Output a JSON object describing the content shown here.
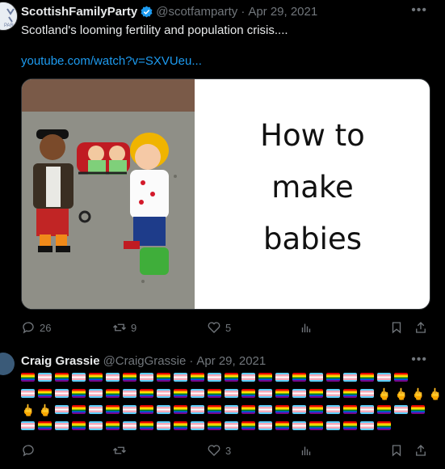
{
  "tweet1": {
    "author_name": "ScottishFamilyParty",
    "handle": "@scotfamparty",
    "separator": "·",
    "date": "Apr 29, 2021",
    "text": "Scotland's looming fertility and population crisis....",
    "link": "youtube.com/watch?v=SXVUeu...",
    "card_lines": [
      "How to",
      "make",
      "babies"
    ],
    "actions": {
      "replies": "26",
      "retweets": "9",
      "likes": "5",
      "views": ""
    }
  },
  "tweet2": {
    "author_name": "Craig Grassie",
    "handle": "@CraigGrassie",
    "separator": "·",
    "date": "Apr 29, 2021",
    "emoji_rows": [
      "RTRTRTRTRTRTRTRTRTRTRTR",
      "TRTRTRTRTRTRTRTRTRTRTMMMM",
      "MMTRTRTRTRTRTRTRTRTRTRTR",
      "TRTRTRTRTRTRTRTRTRTRTR"
    ],
    "actions": {
      "replies": "",
      "retweets": "",
      "likes": "3",
      "views": ""
    }
  },
  "colors": {
    "background": "#000000",
    "text": "#e7e9ea",
    "muted": "#71767b",
    "link": "#1d9bf0",
    "verified": "#1d9bf0"
  },
  "icons": {
    "more": "more-icon",
    "verified": "verified-badge-icon",
    "reply": "reply-icon",
    "retweet": "retweet-icon",
    "like": "heart-icon",
    "views": "views-icon",
    "bookmark": "bookmark-icon",
    "share": "share-icon"
  }
}
